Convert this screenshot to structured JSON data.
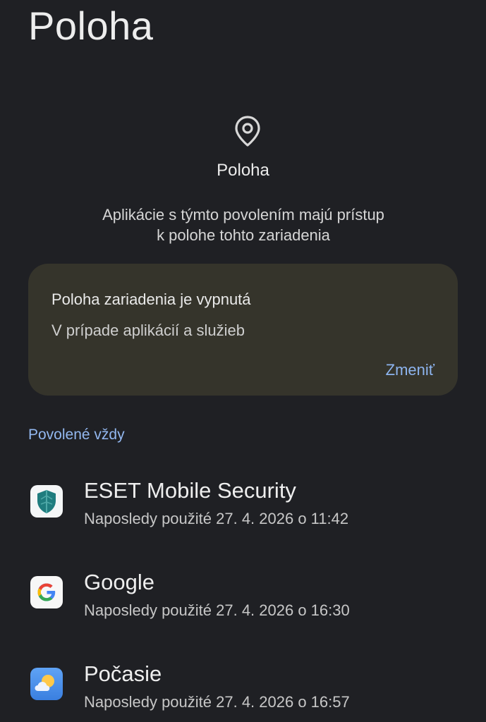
{
  "page": {
    "title": "Poloha"
  },
  "header": {
    "icon": "location-pin-icon",
    "label": "Poloha",
    "description_line1": "Aplikácie s týmto povolením majú prístup",
    "description_line2": "k polohe tohto zariadenia"
  },
  "location_card": {
    "title": "Poloha zariadenia je vypnutá",
    "subtitle": "V prípade aplikácií a služieb",
    "action_label": "Zmeniť"
  },
  "section": {
    "header": "Povolené vždy"
  },
  "apps": [
    {
      "name": "ESET Mobile Security",
      "last_used": "Naposledy použité 27. 4. 2026 o 11:42",
      "icon": "eset-shield-icon"
    },
    {
      "name": "Google",
      "last_used": "Naposledy použité 27. 4. 2026 o 16:30",
      "icon": "google-g-icon"
    },
    {
      "name": "Počasie",
      "last_used": "Naposledy použité 27. 4. 2026 o 16:57",
      "icon": "weather-sun-cloud-icon"
    }
  ],
  "colors": {
    "background": "#1f2024",
    "card_background": "#35342b",
    "accent_blue": "#93b8f0",
    "action_blue": "#8db4ef"
  }
}
